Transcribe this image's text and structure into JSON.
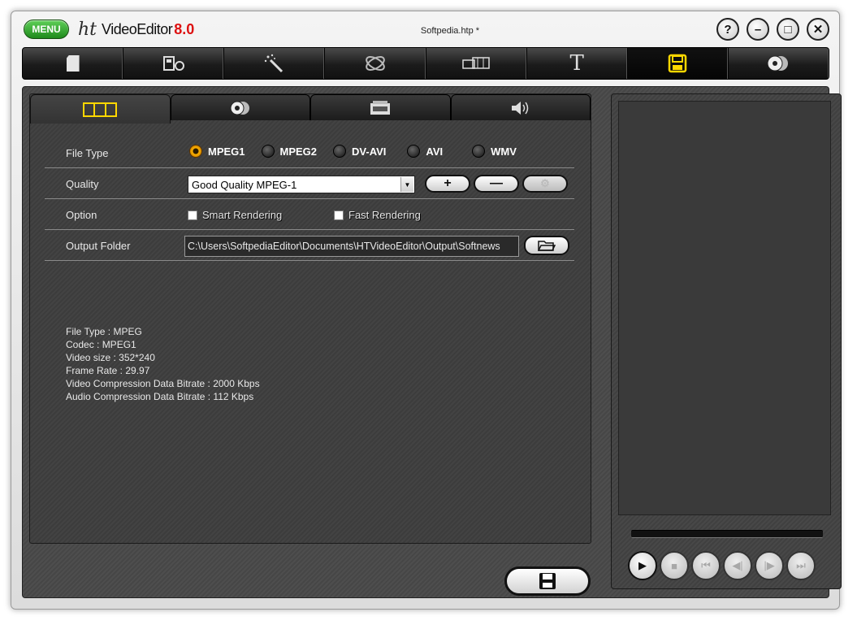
{
  "titlebar": {
    "menu_label": "MENU",
    "logo_mark": "ht",
    "app_name": "VideoEditor",
    "version": "8.0",
    "document_title": "Softpedia.htp *",
    "help_label": "?",
    "minimize_label": "–",
    "maximize_label": "□",
    "close_label": "✕"
  },
  "toolbar": {
    "active_tool": "save",
    "tools": [
      {
        "icon": "new-document-icon",
        "glyph": "▮"
      },
      {
        "icon": "capture-icon",
        "glyph": "⧉"
      },
      {
        "icon": "magic-wand-icon",
        "glyph": "✧"
      },
      {
        "icon": "effects-icon",
        "glyph": "⚙"
      },
      {
        "icon": "filmstrip-icon",
        "glyph": "▭"
      },
      {
        "icon": "text-icon",
        "glyph": "T"
      },
      {
        "icon": "save-icon",
        "glyph": "▣"
      },
      {
        "icon": "disc-burn-icon",
        "glyph": "◉"
      }
    ]
  },
  "subtabs": [
    {
      "icon": "video-tab-icon",
      "glyph": "▥"
    },
    {
      "icon": "disc-tab-icon",
      "glyph": "◉"
    },
    {
      "icon": "device-tab-icon",
      "glyph": "▤"
    },
    {
      "icon": "audio-tab-icon",
      "glyph": "◁)"
    }
  ],
  "file_type": {
    "label": "File Type",
    "selected": "MPEG1",
    "options": [
      "MPEG1",
      "MPEG2",
      "DV-AVI",
      "AVI",
      "WMV"
    ]
  },
  "quality": {
    "label": "Quality",
    "value": "Good  Quality MPEG-1",
    "add_label": "+",
    "remove_label": "—",
    "settings_label": "⚙"
  },
  "option": {
    "label": "Option",
    "smart_rendering": "Smart Rendering",
    "fast_rendering": "Fast Rendering"
  },
  "output_folder": {
    "label": "Output Folder",
    "path": "C:\\Users\\SoftpediaEditor\\Documents\\HTVideoEditor\\Output\\Softnews",
    "browse_icon": "folder-open-icon"
  },
  "info_lines": [
    "File Type : MPEG",
    "Codec : MPEG1",
    "Video size : 352*240",
    "Frame Rate : 29.97",
    "Video Compression Data Bitrate : 2000 Kbps",
    "Audio Compression Data Bitrate : 112 Kbps"
  ],
  "save_button_icon": "save-icon",
  "player": {
    "progress": 0,
    "controls": [
      {
        "name": "play-button",
        "glyph": "▶",
        "enabled": true
      },
      {
        "name": "stop-button",
        "glyph": "■",
        "enabled": false
      },
      {
        "name": "go-start-button",
        "glyph": "⏮",
        "enabled": false
      },
      {
        "name": "step-back-button",
        "glyph": "◀|",
        "enabled": false
      },
      {
        "name": "step-forward-button",
        "glyph": "|▶",
        "enabled": false
      },
      {
        "name": "go-end-button",
        "glyph": "⏭",
        "enabled": false
      }
    ]
  }
}
